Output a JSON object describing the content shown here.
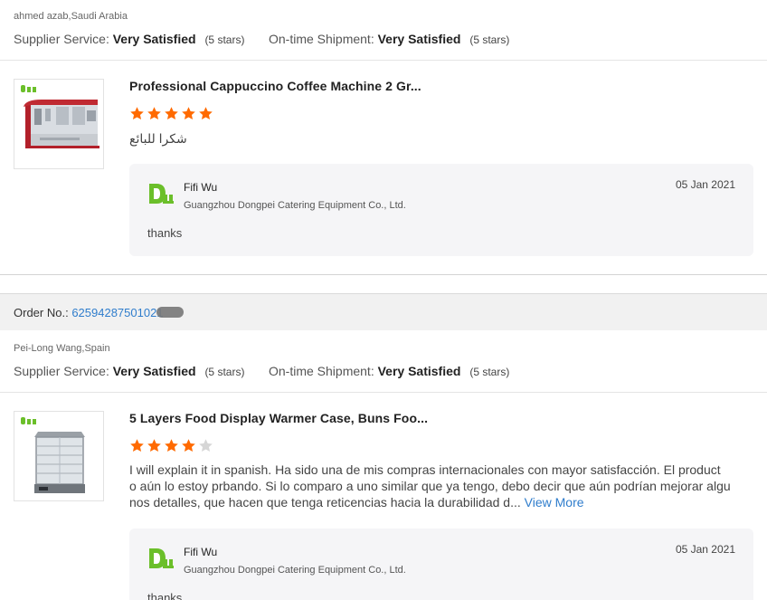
{
  "reviews": [
    {
      "reviewer": "ahmed azab,Saudi Arabia",
      "supplier_service_label": "Supplier Service:",
      "supplier_service_value": "Very Satisfied",
      "supplier_service_stars": "(5 stars)",
      "shipment_label": "On-time Shipment:",
      "shipment_value": "Very Satisfied",
      "shipment_stars": "(5 stars)",
      "product_title": "Professional Cappuccino Coffee Machine 2 Gr...",
      "rating": 5,
      "comment": "شكرا للبائع",
      "reply": {
        "name": "Fifi Wu",
        "company": "Guangzhou Dongpei Catering Equipment Co., Ltd.",
        "date": "05 Jan 2021",
        "text": "thanks"
      }
    },
    {
      "order_label": "Order No.:",
      "order_number": "62594287501021",
      "reviewer": "Pei-Long Wang,Spain",
      "supplier_service_label": "Supplier Service:",
      "supplier_service_value": "Very Satisfied",
      "supplier_service_stars": "(5 stars)",
      "shipment_label": "On-time Shipment:",
      "shipment_value": "Very Satisfied",
      "shipment_stars": "(5 stars)",
      "product_title": "5 Layers Food Display Warmer Case, Buns Foo...",
      "rating": 4,
      "comment_lines": [
        "I will explain it in spanish. Ha sido una de mis compras internacionales con mayor satisfacción. El product",
        "o aún lo estoy prbando. Si lo comparo a uno similar que ya tengo, debo decir que aún podrían mejorar algu",
        "nos detalles, que hacen que tenga reticencias hacia la durabilidad d..."
      ],
      "view_more": "View More",
      "reply": {
        "name": "Fifi Wu",
        "company": "Guangzhou Dongpei Catering Equipment Co., Ltd.",
        "date": "05 Jan 2021",
        "text": "thanks"
      }
    }
  ],
  "colors": {
    "star_filled": "#ff6a00",
    "star_empty": "#d6d6d6",
    "link": "#2f7dcc",
    "logo_green": "#6bbf2a"
  },
  "icons": {
    "supplier_logo": "dongpei-logo-icon",
    "star": "star-icon"
  }
}
